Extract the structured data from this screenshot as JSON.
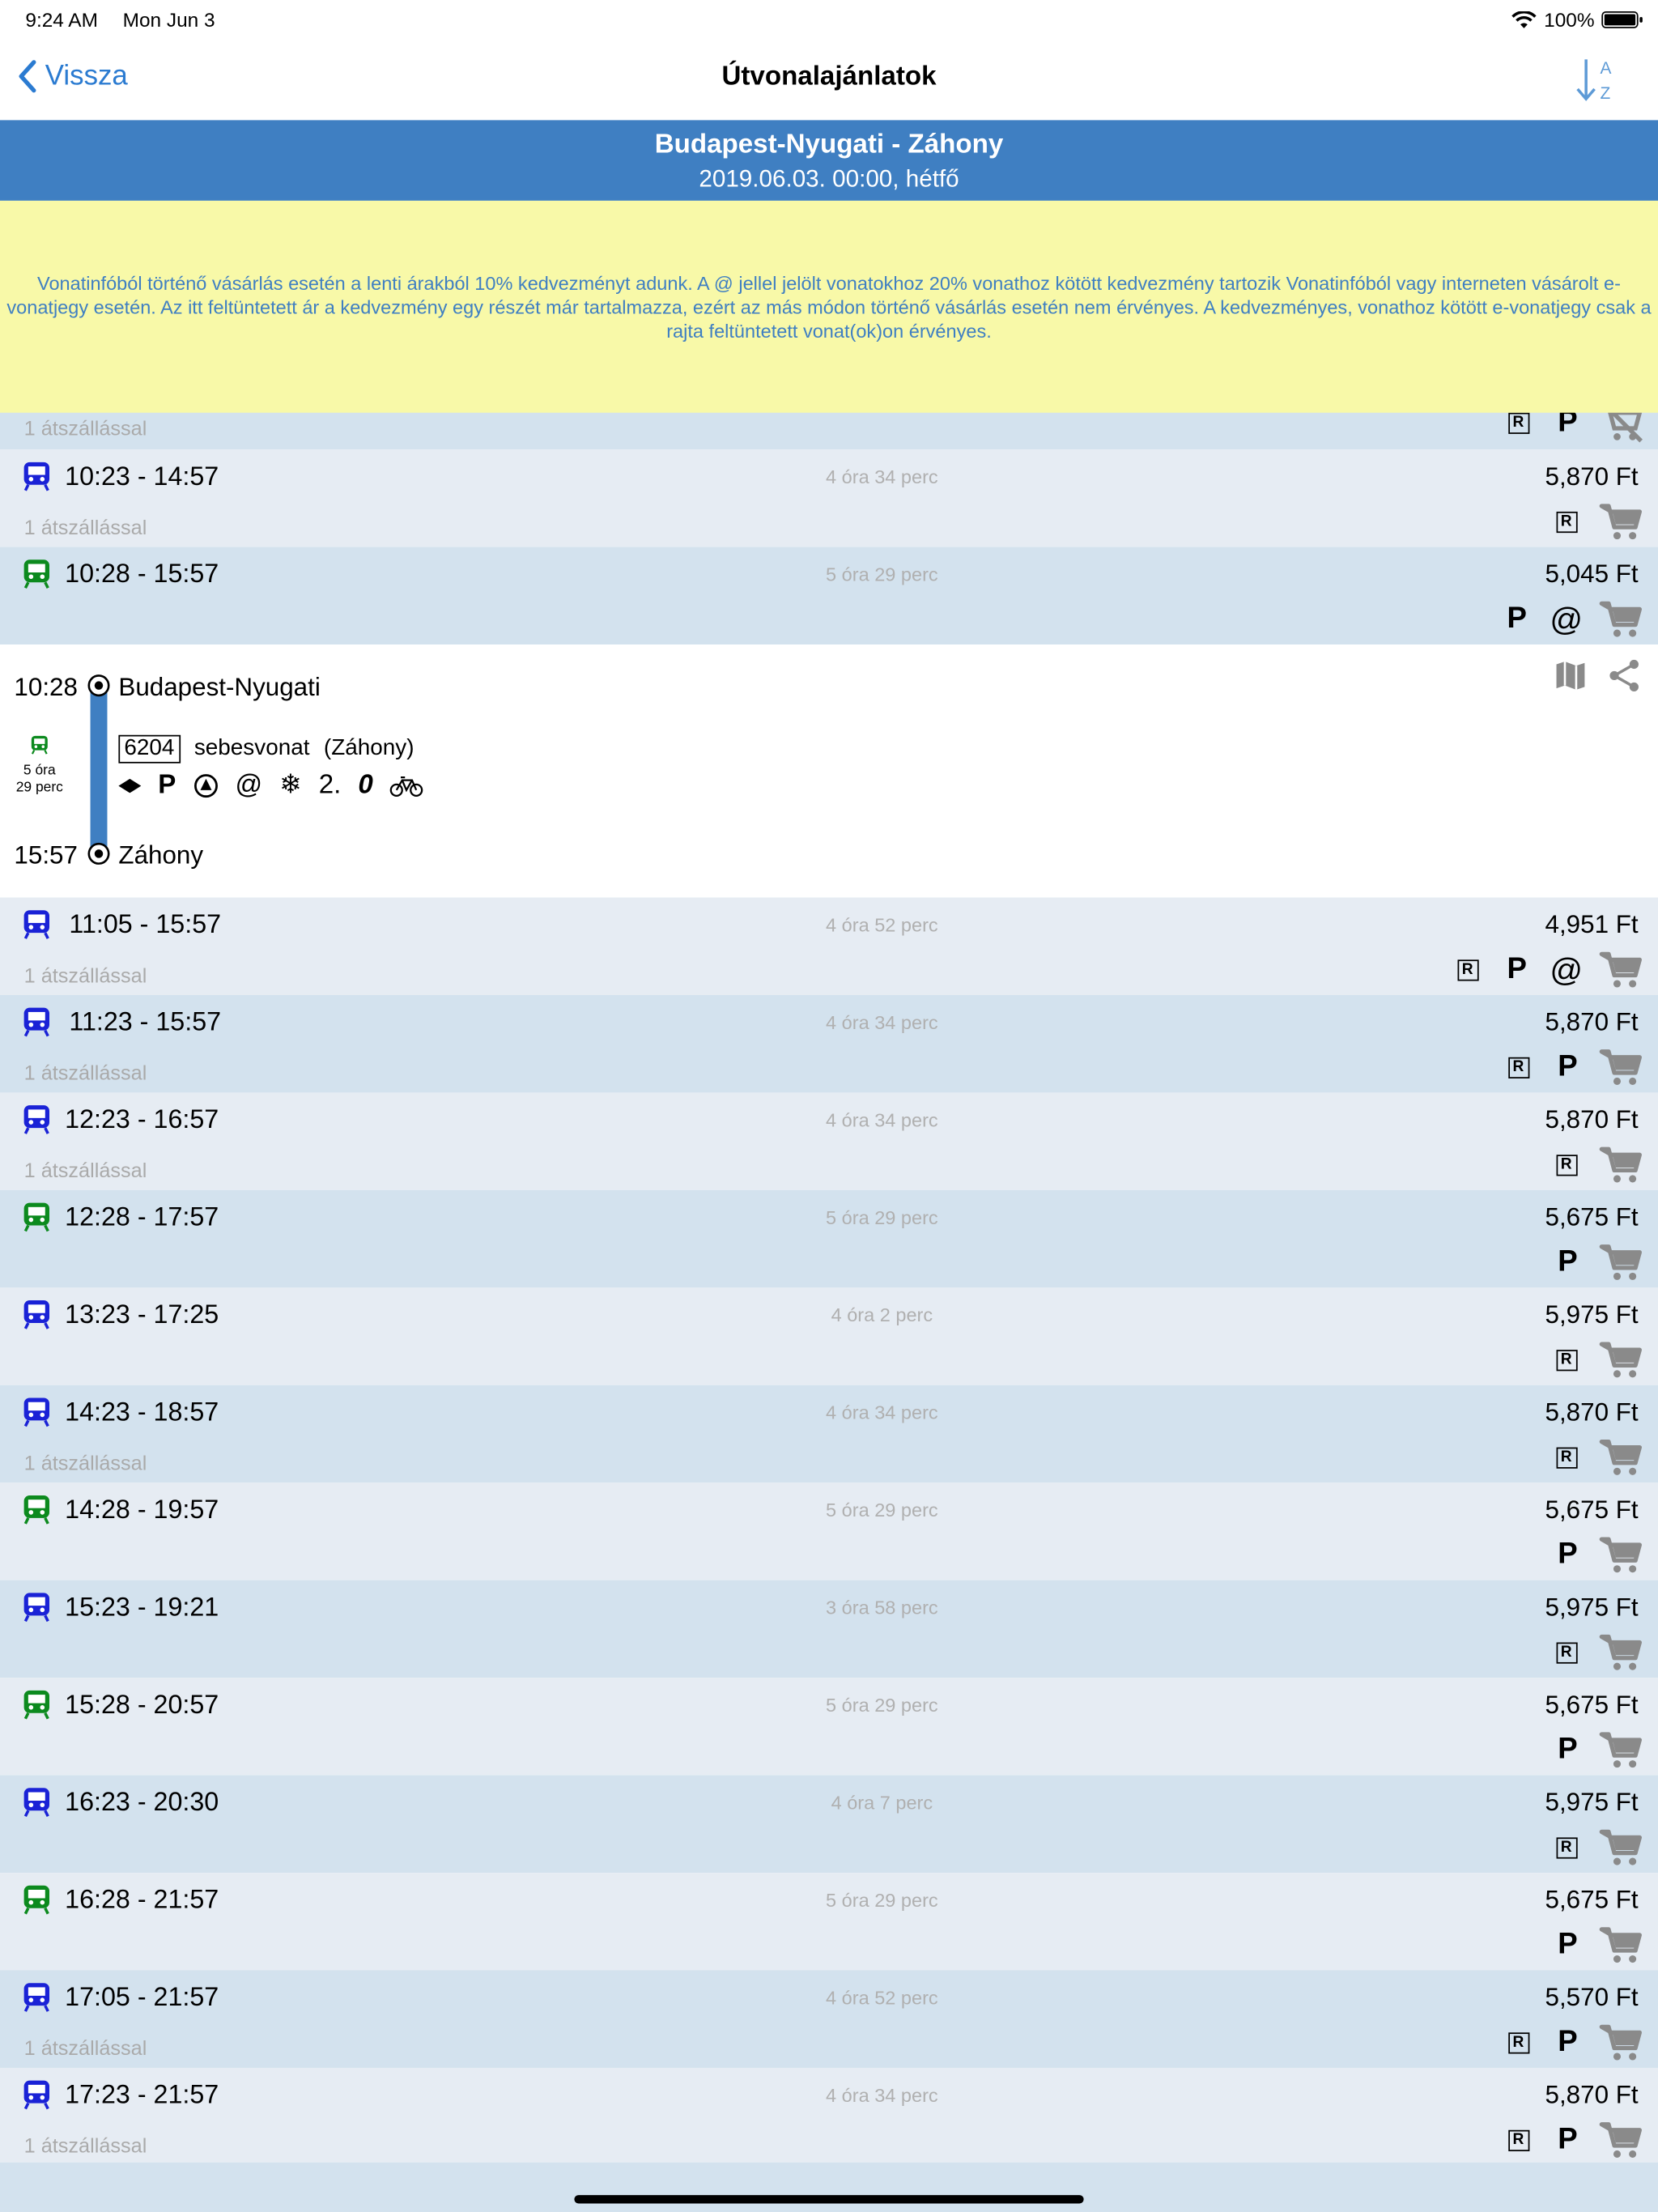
{
  "status": {
    "time": "9:24 AM",
    "date": "Mon Jun 3",
    "battery": "100%"
  },
  "nav": {
    "back_label": "Vissza",
    "title": "Útvonalajánlatok",
    "sort_a": "A",
    "sort_z": "Z"
  },
  "route": {
    "title": "Budapest-Nyugati - Záhony",
    "datetime": "2019.06.03. 00:00, hétfő"
  },
  "notice": "Vonatinfóból történő vásárlás esetén a lenti árakból 10% kedvezményt adunk. A @ jellel jelölt vonatokhoz 20% vonathoz kötött kedvezmény tartozik Vonatinfóból vagy interneten vásárolt e-vonatjegy esetén. Az itt feltüntetett ár a kedvezmény egy részét már tartalmazza, ezért az más módon történő vásárlás esetén nem érvényes. A kedvezményes, vonathoz kötött e-vonatjegy csak a rajta feltüntetett vonat(ok)on érvényes.",
  "partial_row": {
    "sub": "1 átszállással"
  },
  "colors": {
    "accent": "#2b7bd1",
    "band": "#3f7fc2",
    "notice_bg": "#f8f9a8",
    "train_blue": "#1a22d6",
    "train_green": "#0c8a1e"
  },
  "rows": [
    {
      "times": "10:23 - 14:57",
      "duration": "4 óra 34 perc",
      "price": "5,870 Ft",
      "sub": "1 átszállással",
      "train": "blue",
      "bg": "light",
      "icons": [
        "R"
      ]
    },
    {
      "times": "10:28 - 15:57",
      "duration": "5 óra 29 perc",
      "price": "5,045 Ft",
      "sub": "",
      "train": "green",
      "bg": "blue",
      "icons": [
        "P",
        "@"
      ]
    }
  ],
  "detail": {
    "dep_time": "10:28",
    "dep_station": "Budapest-Nyugati",
    "arr_time": "15:57",
    "arr_station": "Záhony",
    "train_number": "6204",
    "train_type": "sebesvonat",
    "train_dest": "(Záhony)",
    "duration_line1": "5 óra",
    "duration_line2": "29 perc",
    "amenity_class": "2."
  },
  "rows2": [
    {
      "times": "11:05 - 15:57",
      "duration": "4 óra 52 perc",
      "price": "4,951 Ft",
      "sub": "1 átszállással",
      "train": "blue",
      "bg": "light",
      "icons": [
        "R",
        "P",
        "@"
      ]
    },
    {
      "times": "11:23 - 15:57",
      "duration": "4 óra 34 perc",
      "price": "5,870 Ft",
      "sub": "1 átszállással",
      "train": "blue",
      "bg": "blue",
      "icons": [
        "R",
        "P"
      ]
    },
    {
      "times": "12:23 - 16:57",
      "duration": "4 óra 34 perc",
      "price": "5,870 Ft",
      "sub": "1 átszállással",
      "train": "blue",
      "bg": "light",
      "icons": [
        "R"
      ]
    },
    {
      "times": "12:28 - 17:57",
      "duration": "5 óra 29 perc",
      "price": "5,675 Ft",
      "sub": "",
      "train": "green",
      "bg": "blue",
      "icons": [
        "P"
      ]
    },
    {
      "times": "13:23 - 17:25",
      "duration": "4 óra 2 perc",
      "price": "5,975 Ft",
      "sub": "",
      "train": "blue",
      "bg": "light",
      "icons": [
        "R"
      ]
    },
    {
      "times": "14:23 - 18:57",
      "duration": "4 óra 34 perc",
      "price": "5,870 Ft",
      "sub": "1 átszállással",
      "train": "blue",
      "bg": "blue",
      "icons": [
        "R"
      ]
    },
    {
      "times": "14:28 - 19:57",
      "duration": "5 óra 29 perc",
      "price": "5,675 Ft",
      "sub": "",
      "train": "green",
      "bg": "light",
      "icons": [
        "P"
      ]
    },
    {
      "times": "15:23 - 19:21",
      "duration": "3 óra 58 perc",
      "price": "5,975 Ft",
      "sub": "",
      "train": "blue",
      "bg": "blue",
      "icons": [
        "R"
      ]
    },
    {
      "times": "15:28 - 20:57",
      "duration": "5 óra 29 perc",
      "price": "5,675 Ft",
      "sub": "",
      "train": "green",
      "bg": "light",
      "icons": [
        "P"
      ]
    },
    {
      "times": "16:23 - 20:30",
      "duration": "4 óra 7 perc",
      "price": "5,975 Ft",
      "sub": "",
      "train": "blue",
      "bg": "blue",
      "icons": [
        "R"
      ]
    },
    {
      "times": "16:28 - 21:57",
      "duration": "5 óra 29 perc",
      "price": "5,675 Ft",
      "sub": "",
      "train": "green",
      "bg": "light",
      "icons": [
        "P"
      ]
    },
    {
      "times": "17:05 - 21:57",
      "duration": "4 óra 52 perc",
      "price": "5,570 Ft",
      "sub": "1 átszállással",
      "train": "blue",
      "bg": "blue",
      "icons": [
        "R",
        "P"
      ]
    },
    {
      "times": "17:23 - 21:57",
      "duration": "4 óra 34 perc",
      "price": "5,870 Ft",
      "sub": "1 átszállással",
      "train": "blue",
      "bg": "light",
      "icons": [
        "R",
        "P"
      ]
    }
  ]
}
